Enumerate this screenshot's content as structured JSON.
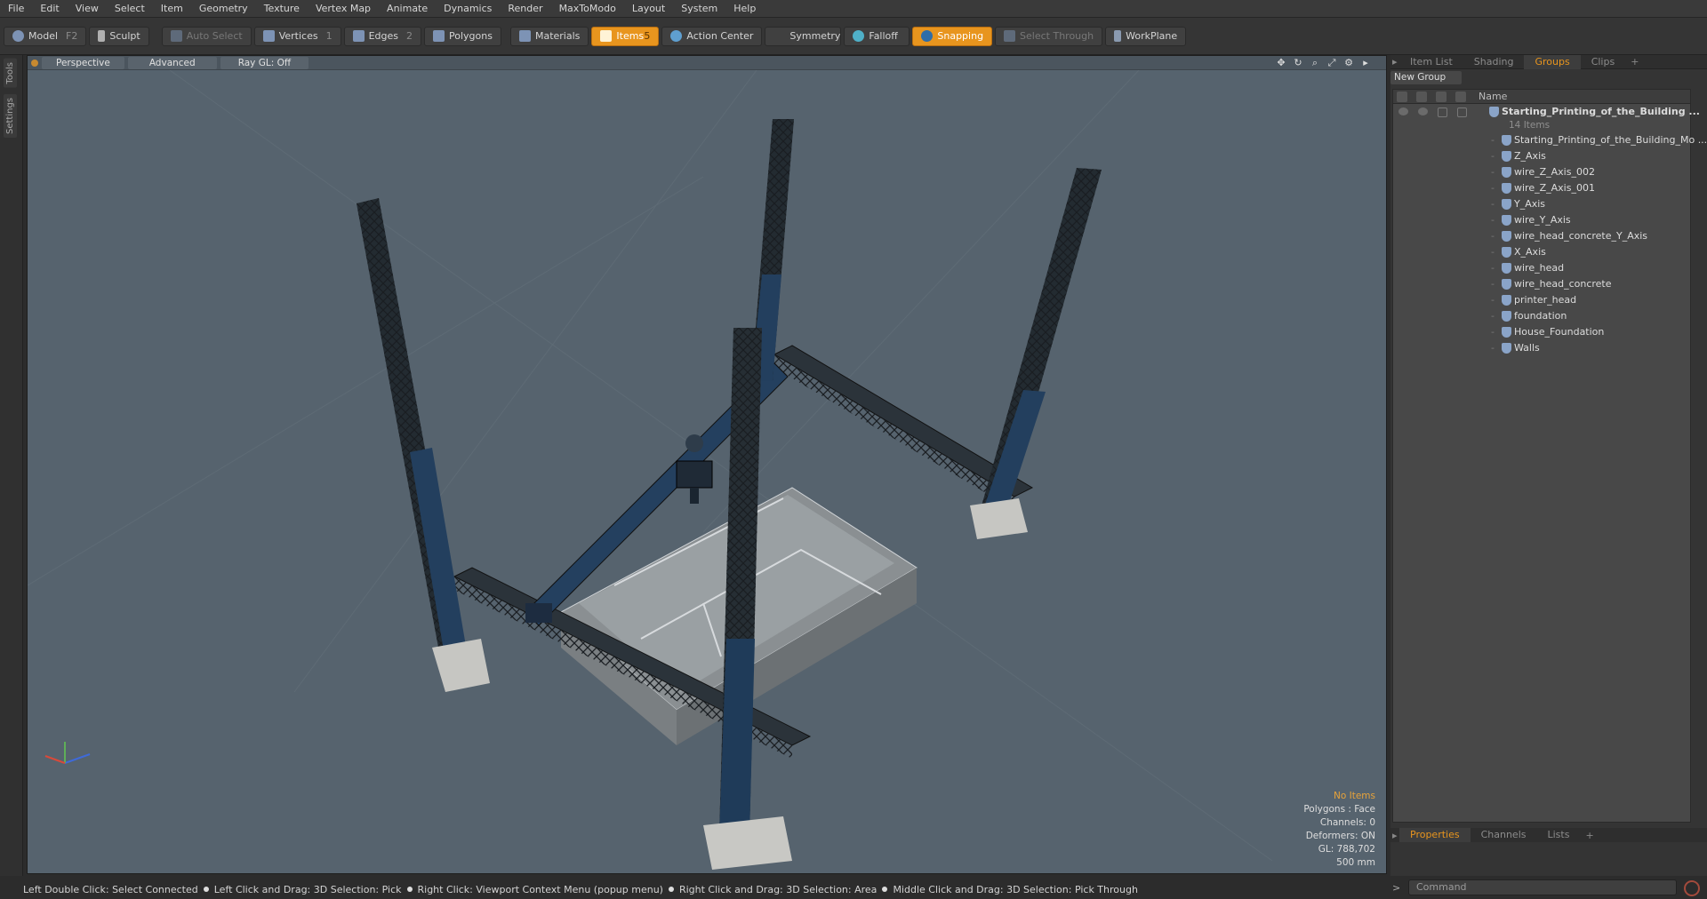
{
  "menu": [
    "File",
    "Edit",
    "View",
    "Select",
    "Item",
    "Geometry",
    "Texture",
    "Vertex Map",
    "Animate",
    "Dynamics",
    "Render",
    "MaxToModo",
    "Layout",
    "System",
    "Help"
  ],
  "toolbar": {
    "model": "Model",
    "model_key": "F2",
    "sculpt": "Sculpt",
    "auto_select": "Auto Select",
    "vertices": "Vertices",
    "vertices_key": "1",
    "edges": "Edges",
    "edges_key": "2",
    "polygons": "Polygons",
    "materials": "Materials",
    "items": "Items",
    "items_key": "5",
    "action_center": "Action Center",
    "symmetry": "Symmetry",
    "falloff": "Falloff",
    "snapping": "Snapping",
    "select_through": "Select Through",
    "workplane": "WorkPlane"
  },
  "left_tabs": [
    "Tools",
    "Settings"
  ],
  "viewport": {
    "view": "Perspective",
    "advanced": "Advanced",
    "raygl": "Ray GL: Off",
    "info": {
      "items": "No Items",
      "polygons": "Polygons : Face",
      "channels": "Channels: 0",
      "deformers": "Deformers: ON",
      "gl": "GL: 788,702",
      "scale": "500 mm"
    }
  },
  "right_panel": {
    "tabs": [
      "Item List",
      "Shading",
      "Groups",
      "Clips"
    ],
    "active_tab": "Groups",
    "new_group": "New Group",
    "name_header": "Name",
    "group_name": "Starting_Printing_of_the_Building ...",
    "group_count": "14 Items",
    "items": [
      "Starting_Printing_of_the_Building_Mo ...",
      "Z_Axis",
      "wire_Z_Axis_002",
      "wire_Z_Axis_001",
      "Y_Axis",
      "wire_Y_Axis",
      "wire_head_concrete_Y_Axis",
      "X_Axis",
      "wire_head",
      "wire_head_concrete",
      "printer_head",
      "foundation",
      "House_Foundation",
      "Walls"
    ],
    "bottom_tabs": [
      "Properties",
      "Channels",
      "Lists"
    ],
    "bottom_active": "Properties"
  },
  "status": {
    "s1": "Left Double Click: Select Connected",
    "s2": "Left Click and Drag: 3D Selection: Pick",
    "s3": "Right Click: Viewport Context Menu (popup menu)",
    "s4": "Right Click and Drag: 3D Selection: Area",
    "s5": "Middle Click and Drag: 3D Selection: Pick Through"
  },
  "command_placeholder": "Command",
  "colors": {
    "accent": "#e8951e",
    "viewport_bg": "#56636e"
  }
}
